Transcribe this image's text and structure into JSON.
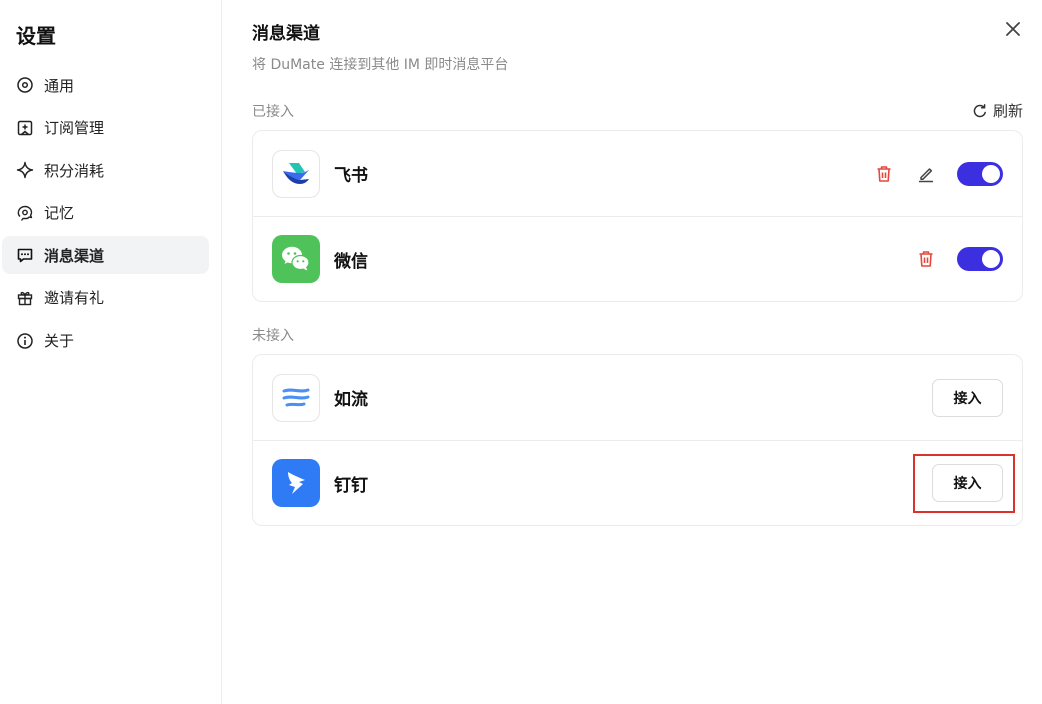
{
  "sidebar": {
    "title": "设置",
    "items": [
      {
        "label": "通用",
        "icon": "settings-icon",
        "active": false
      },
      {
        "label": "订阅管理",
        "icon": "subscription-icon",
        "active": false
      },
      {
        "label": "积分消耗",
        "icon": "sparkle-icon",
        "active": false
      },
      {
        "label": "记忆",
        "icon": "memory-icon",
        "active": false
      },
      {
        "label": "消息渠道",
        "icon": "message-icon",
        "active": true
      },
      {
        "label": "邀请有礼",
        "icon": "gift-icon",
        "active": false
      },
      {
        "label": "关于",
        "icon": "info-icon",
        "active": false
      }
    ]
  },
  "main": {
    "title": "消息渠道",
    "subtitle": "将 DuMate 连接到其他 IM 即时消息平台",
    "refresh_label": "刷新",
    "connected_label": "已接入",
    "unconnected_label": "未接入",
    "connected": [
      {
        "name": "飞书",
        "icon": "feishu-logo-icon",
        "enabled": true,
        "editable": true
      },
      {
        "name": "微信",
        "icon": "wechat-logo-icon",
        "enabled": true,
        "editable": false
      }
    ],
    "unconnected": [
      {
        "name": "如流",
        "icon": "ruliu-logo-icon",
        "button": "接入"
      },
      {
        "name": "钉钉",
        "icon": "dingtalk-logo-icon",
        "button": "接入"
      }
    ]
  },
  "colors": {
    "accent": "#3b2fe0",
    "danger": "#e5473c",
    "wechat": "#4fc25a",
    "dingtalk": "#2f7bf5",
    "highlight": "#d9342b"
  }
}
